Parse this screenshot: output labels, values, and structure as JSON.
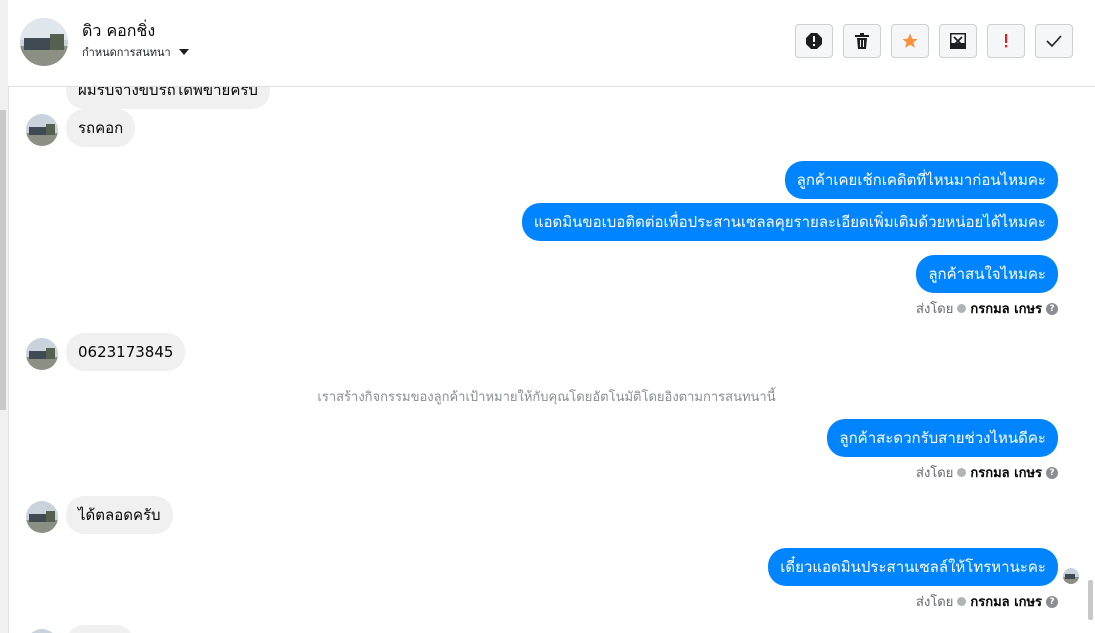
{
  "header": {
    "contact_name": "ดิว คอกชิ่ง",
    "subtitle": "กำหนดการสนทนา"
  },
  "toolbar": [
    {
      "icon": "alert-octagon-icon"
    },
    {
      "icon": "trash-icon"
    },
    {
      "icon": "star-icon",
      "color": "#f7923a"
    },
    {
      "icon": "envelope-x-icon"
    },
    {
      "icon": "exclamation-icon",
      "color": "#e02020"
    },
    {
      "icon": "check-icon"
    }
  ],
  "messages": {
    "in_partial": "ผมรบจางขบรถไดพขายครบ",
    "in_1": "รถคอก",
    "out_1": "ลูกค้าเคยเช้กเคดิตที่ไหนมาก่อนไหมคะ",
    "out_2": "แอดมินขอเบอติดต่อเพื่อประสานเซลลคุยรายละเอียดเพิ่มเติมด้วยหน่อยได้ไหมคะ",
    "out_3": "ลูกค้าสนใจไหมคะ",
    "in_2": "0623173845",
    "system_note": "เราสร้างกิจกรรมของลูกค้าเป้าหมายให้กับคุณโดยอัตโนมัติโดยอิงตามการสนทนานี้",
    "out_4": "ลูกค้าสะดวกรับสายช่วงไหนดีคะ",
    "in_3": "ได้ตลอดครับ",
    "out_5": "เดี๋ยวแอดมินประสานเซลล์ให้โทรหานะคะ"
  },
  "sent_by": {
    "prefix": "ส่งโดย",
    "agent": "กรกมล เกษร"
  },
  "colors": {
    "outgoing_bubble": "#0084ff",
    "incoming_bubble": "#f0f0f0"
  }
}
